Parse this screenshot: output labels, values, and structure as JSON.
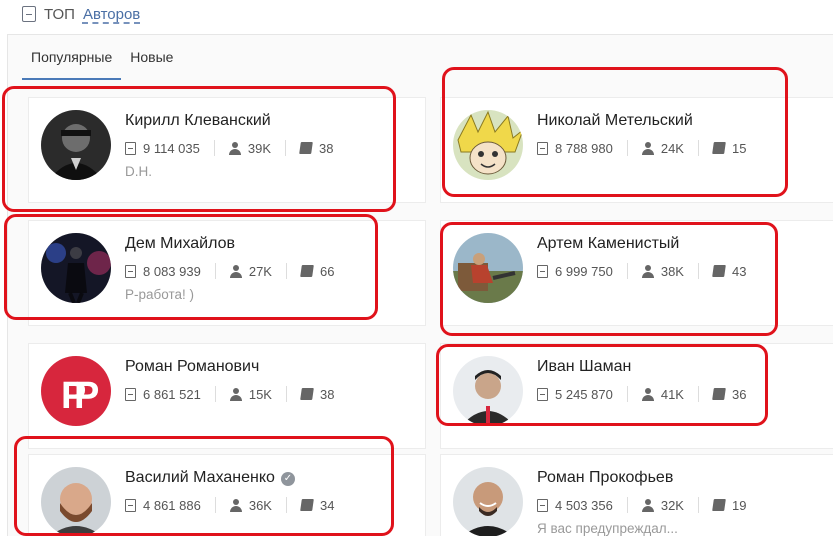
{
  "header": {
    "icon": "book-icon",
    "top_label": "ТОП",
    "authors_link": "Авторов"
  },
  "tabs": [
    {
      "label": "Популярные",
      "active": true
    },
    {
      "label": "Новые",
      "active": false
    }
  ],
  "authors": [
    {
      "name": "Кирилл Клеванский",
      "views": "9 114 035",
      "followers": "39K",
      "books": "38",
      "desc": "D.H.",
      "avatar": "photo-dark-portrait"
    },
    {
      "name": "Николай Метельский",
      "views": "8 788 980",
      "followers": "24K",
      "books": "15",
      "desc": "",
      "avatar": "anime-yellow-hair"
    },
    {
      "name": "Дем Михайлов",
      "views": "8 083 939",
      "followers": "27K",
      "books": "66",
      "desc": "Р-работа! )",
      "avatar": "dark-figure-neon"
    },
    {
      "name": "Артем Каменистый",
      "views": "6 999 750",
      "followers": "38K",
      "books": "43",
      "desc": "",
      "avatar": "outdoor-photo"
    },
    {
      "name": "Роман Романович",
      "views": "6 861 521",
      "followers": "15K",
      "books": "38",
      "desc": "",
      "avatar": "red-pr-logo",
      "logo_text": "P"
    },
    {
      "name": "Иван Шаман",
      "views": "5 245 870",
      "followers": "41K",
      "books": "36",
      "desc": "",
      "avatar": "man-portrait"
    },
    {
      "name": "Василий Маханенко",
      "views": "4 861 886",
      "followers": "36K",
      "books": "34",
      "desc": "",
      "avatar": "bearded-man",
      "verified": true
    },
    {
      "name": "Роман Прокофьев",
      "views": "4 503 356",
      "followers": "32K",
      "books": "19",
      "desc": "Я вас предупреждал...",
      "avatar": "bald-man-smile"
    }
  ],
  "colors": {
    "accent": "#4a7ab8",
    "highlight": "#e0121b",
    "logo_red": "#d7263d"
  }
}
